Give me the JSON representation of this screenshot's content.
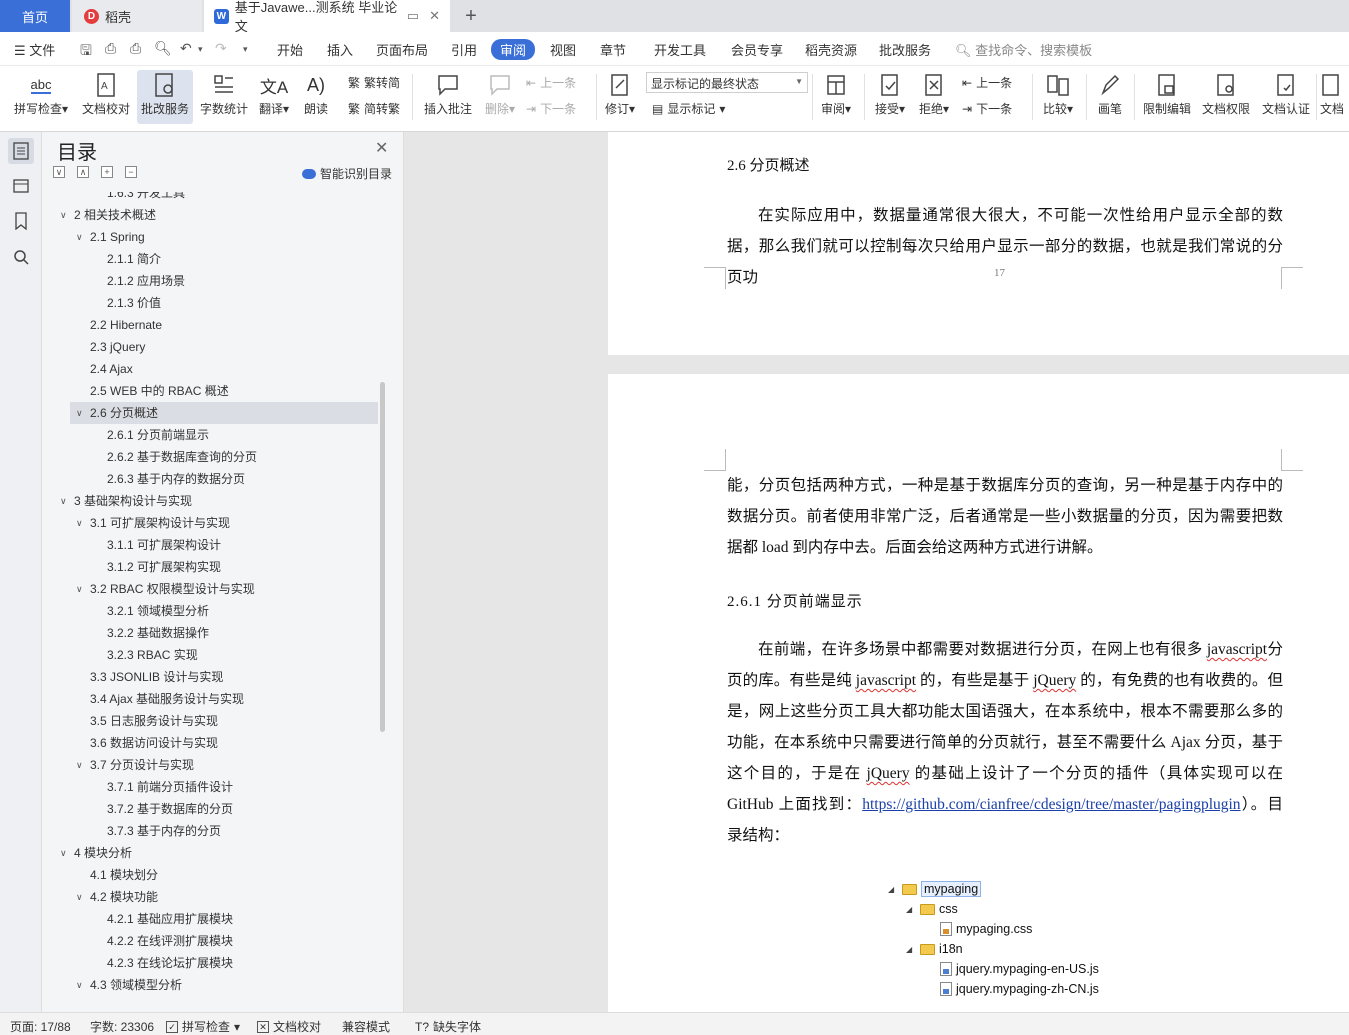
{
  "tabs": {
    "home": "首页",
    "daoke": "稻壳",
    "doc": "基于Javawe...测系统 毕业论文"
  },
  "menu": {
    "file": "文件",
    "items": [
      "开始",
      "插入",
      "页面布局",
      "引用",
      "审阅",
      "视图",
      "章节",
      "开发工具",
      "会员专享",
      "稻壳资源",
      "批改服务"
    ],
    "search": "查找命令、搜索模板"
  },
  "ribbon": {
    "spell": "拼写检查",
    "proof": "文档校对",
    "batch": "批改服务",
    "wordcount": "字数统计",
    "translate": "翻译",
    "read": "朗读",
    "trad": "繁转简",
    "simp": "简转繁",
    "insert_comment": "插入批注",
    "delete": "删除",
    "prev": "上一条",
    "next": "下一条",
    "revise": "修订",
    "markup_state": "显示标记的最终状态",
    "show_markup": "显示标记",
    "review": "审阅",
    "accept": "接受",
    "reject": "拒绝",
    "prev2": "上一条",
    "next2": "下一条",
    "compare": "比较",
    "pen": "画笔",
    "restrict": "限制编辑",
    "perm": "文档权限",
    "cert": "文档认证",
    "more": "文档"
  },
  "toc": {
    "title": "目录",
    "smart": "智能识别目录",
    "items": [
      {
        "t": "1.6.3  开发工具",
        "l": 3
      },
      {
        "t": "2  相关技术概述",
        "l": 1,
        "c": true
      },
      {
        "t": "2.1 Spring",
        "l": 2,
        "c": true
      },
      {
        "t": "2.1.1  简介",
        "l": 3
      },
      {
        "t": "2.1.2  应用场景",
        "l": 3
      },
      {
        "t": "2.1.3  价值",
        "l": 3
      },
      {
        "t": "2.2 Hibernate",
        "l": 2
      },
      {
        "t": "2.3 jQuery",
        "l": 2
      },
      {
        "t": "2.4 Ajax",
        "l": 2
      },
      {
        "t": "2.5 WEB 中的 RBAC 概述",
        "l": 2
      },
      {
        "t": "2.6  分页概述",
        "l": 2,
        "c": true,
        "sel": true
      },
      {
        "t": "2.6.1  分页前端显示",
        "l": 3
      },
      {
        "t": "2.6.2  基于数据库查询的分页",
        "l": 3
      },
      {
        "t": "2.6.3  基于内存的数据分页",
        "l": 3
      },
      {
        "t": "3  基础架构设计与实现",
        "l": 1,
        "c": true
      },
      {
        "t": "3.1  可扩展架构设计与实现",
        "l": 2,
        "c": true
      },
      {
        "t": "3.1.1  可扩展架构设计",
        "l": 3
      },
      {
        "t": "3.1.2  可扩展架构实现",
        "l": 3
      },
      {
        "t": "3.2 RBAC 权限模型设计与实现",
        "l": 2,
        "c": true
      },
      {
        "t": "3.2.1  领域模型分析",
        "l": 3
      },
      {
        "t": "3.2.2  基础数据操作",
        "l": 3
      },
      {
        "t": "3.2.3 RBAC 实现",
        "l": 3
      },
      {
        "t": "3.3 JSONLIB 设计与实现",
        "l": 2
      },
      {
        "t": "3.4 Ajax 基础服务设计与实现",
        "l": 2
      },
      {
        "t": "3.5  日志服务设计与实现",
        "l": 2
      },
      {
        "t": "3.6  数据访问设计与实现",
        "l": 2
      },
      {
        "t": "3.7  分页设计与实现",
        "l": 2,
        "c": true
      },
      {
        "t": "3.7.1  前端分页插件设计",
        "l": 3
      },
      {
        "t": "3.7.2  基于数据库的分页",
        "l": 3
      },
      {
        "t": "3.7.3  基于内存的分页",
        "l": 3
      },
      {
        "t": "4  模块分析",
        "l": 1,
        "c": true
      },
      {
        "t": "4.1  模块划分",
        "l": 2
      },
      {
        "t": "4.2  模块功能",
        "l": 2,
        "c": true
      },
      {
        "t": "4.2.1  基础应用扩展模块",
        "l": 3
      },
      {
        "t": "4.2.2  在线评测扩展模块",
        "l": 3
      },
      {
        "t": "4.2.3  在线论坛扩展模块",
        "l": 3
      },
      {
        "t": "4.3  领域模型分析",
        "l": 2,
        "c": true
      }
    ]
  },
  "doc": {
    "h26": "2.6  分页概述",
    "p1": "在实际应用中，数据量通常很大很大，不可能一次性给用户显示全部的数据，那么我们就可以控制每次只给用户显示一部分的数据，也就是我们常说的分页功",
    "page_no": "17",
    "p2": "能，分页包括两种方式，一种是基于数据库分页的查询，另一种是基于内存中的数据分页。前者使用非常广泛，后者通常是一些小数据量的分页，因为需要把数据都 load 到内存中去。后面会给这两种方式进行讲解。",
    "h261": "2.6.1  分页前端显示",
    "p3a": "在前端，在许多场景中都需要对数据进行分页，在网上也有很多 ",
    "w_js": "javascript",
    "p3b": "分页的库。有些是纯 ",
    "w_js2": "javascript",
    "p3c": " 的，有些是基于 ",
    "w_jq": "jQuery",
    "p3d": " 的，有免费的也有收费的。但是，网上这些分页工具大都功能太国语强大，在本系统中，根本不需要那么多的功能，在本系统中只需要进行简单的分页就行，甚至不需要什么 Ajax 分页，基于这个目的，于是在 ",
    "w_jq2": "jQuery",
    "p3e": " 的基础上设计了一个分页的插件（具体实现可以在 GitHub 上面找到：",
    "link": "https://github.com/cianfree/cdesign/tree/master/pagingplugin",
    "p3f": "）。目录结构："
  },
  "tree": {
    "root": "mypaging",
    "css": "css",
    "css_file": "mypaging.css",
    "i18n": "i18n",
    "f1": "jquery.mypaging-en-US.js",
    "f2": "jquery.mypaging-zh-CN.js"
  },
  "status": {
    "page": "页面: 17/88",
    "words": "字数: 23306",
    "spell": "拼写检查",
    "proof": "文档校对",
    "compat": "兼容模式",
    "missing_font": "缺失字体"
  },
  "colors": {
    "accent": "#3b6fd8",
    "ribbon_bg": "#ffffff",
    "page_bg": "#e6e6e6"
  }
}
